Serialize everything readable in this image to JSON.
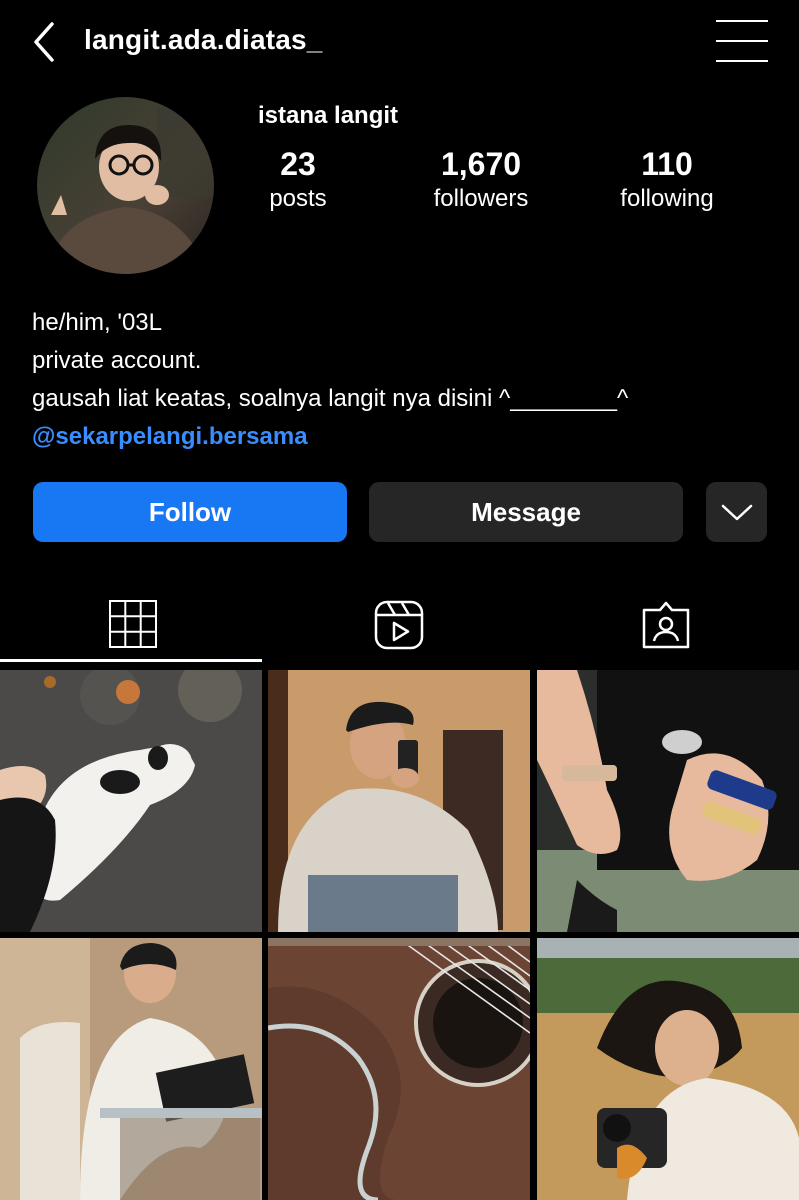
{
  "header": {
    "username": "langit.ada.diatas_",
    "back_icon": "chevron-left-icon",
    "menu_icon": "hamburger-menu-icon"
  },
  "profile": {
    "display_name": "istana langit",
    "stats": [
      {
        "value": "23",
        "label": "posts"
      },
      {
        "value": "1,670",
        "label": "followers"
      },
      {
        "value": "110",
        "label": "following"
      }
    ],
    "bio_lines": [
      "he/him, '03L",
      "private account.",
      "gausah liat keatas, soalnya langit nya disini ^________^"
    ],
    "mention": "@sekarpelangi.bersama"
  },
  "actions": {
    "follow_label": "Follow",
    "message_label": "Message",
    "more_icon": "chevron-down-icon"
  },
  "tabs": [
    {
      "name": "posts-grid",
      "icon": "grid-icon",
      "active": true
    },
    {
      "name": "reels",
      "icon": "reels-icon",
      "active": false
    },
    {
      "name": "tagged",
      "icon": "tagged-person-icon",
      "active": false
    }
  ],
  "colors": {
    "background": "#000000",
    "follow_button": "#1877f2",
    "secondary_button": "#262626",
    "mention_link": "#3a8dff"
  },
  "posts": [
    {
      "subject": "white cat with black spots on asphalt"
    },
    {
      "subject": "person in cap taking mirror selfie"
    },
    {
      "subject": "hands with bandage stickers"
    },
    {
      "subject": "person typing on tablet at table"
    },
    {
      "subject": "acoustic guitar close-up"
    },
    {
      "subject": "person with camera in wheat field"
    }
  ]
}
